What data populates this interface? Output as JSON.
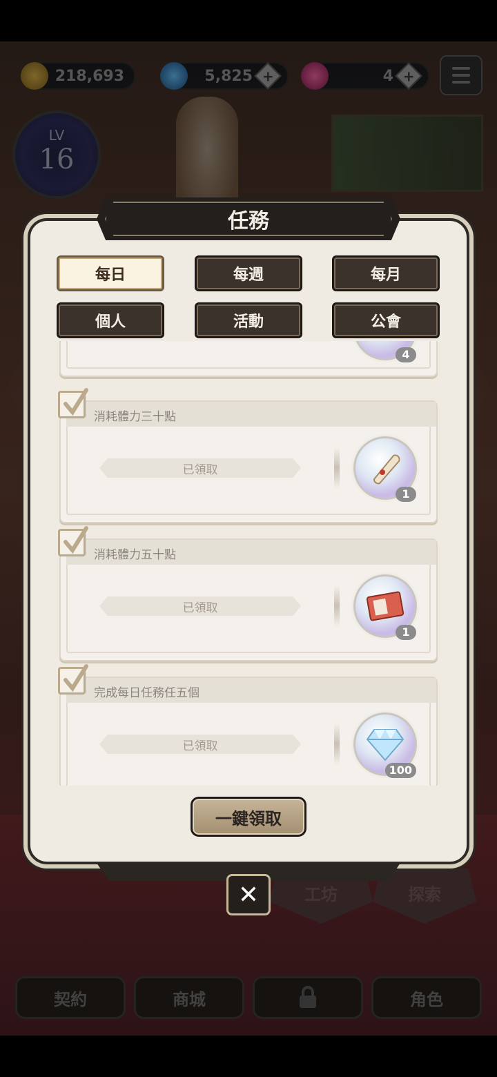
{
  "top_bar": {
    "gold": "218,693",
    "gems": "5,825",
    "tokens": "4",
    "level_label": "LV",
    "level_value": "16"
  },
  "bottom_nav": {
    "items": [
      "契約",
      "商城",
      "",
      "角色"
    ],
    "hex_buttons": [
      "工坊",
      "探索"
    ]
  },
  "modal": {
    "title": "任務",
    "tabs": [
      {
        "label": "每日",
        "active": true
      },
      {
        "label": "每週",
        "active": false
      },
      {
        "label": "每月",
        "active": false
      },
      {
        "label": "個人",
        "active": false
      },
      {
        "label": "活動",
        "active": false
      },
      {
        "label": "公會",
        "active": false
      }
    ],
    "quests": [
      {
        "title": "",
        "status": "",
        "reward_count": "4"
      },
      {
        "title": "消耗體力三十點",
        "status": "已領取",
        "reward_count": "1",
        "reward_icon": "scroll-icon"
      },
      {
        "title": "消耗體力五十點",
        "status": "已領取",
        "reward_count": "1",
        "reward_icon": "ticket-icon"
      },
      {
        "title": "完成每日任務任五個",
        "status": "已領取",
        "reward_count": "100",
        "reward_icon": "diamond-icon"
      }
    ],
    "claim_all_label": "一鍵領取",
    "close_label": "✕"
  },
  "colors": {
    "panel_bg": "#efebe3",
    "tab_dark": "#3b322c",
    "tab_active": "#fbf3e1",
    "accent_gold": "#bba98c"
  }
}
